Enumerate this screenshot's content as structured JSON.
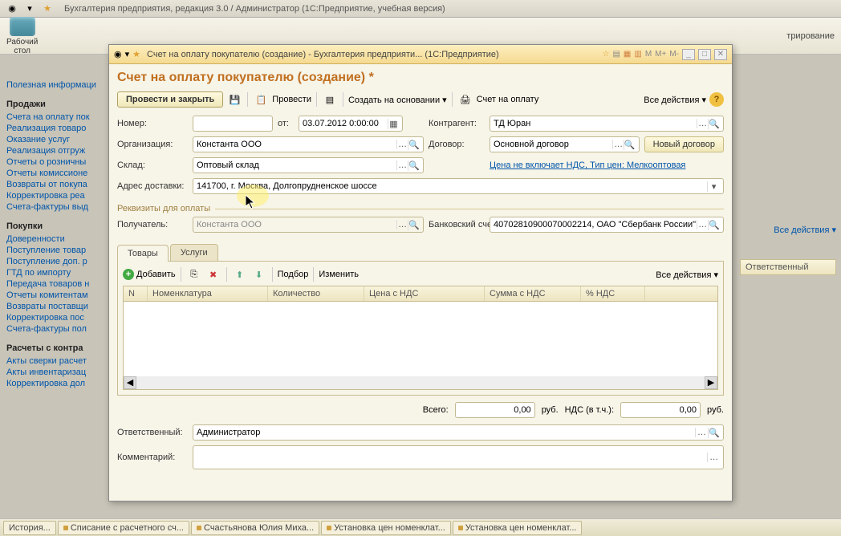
{
  "app_title": "Бухгалтерия предприятия, редакция 3.0 / Администратор    (1С:Предприятие, учебная версия)",
  "desktop": {
    "label": "Рабочий\nстол"
  },
  "admin_label": "трирование",
  "nav": {
    "info": "Полезная информаци",
    "sales": {
      "hdr": "Продажи",
      "items": [
        "Счета на оплату пок",
        "Реализация товаро",
        "Оказание услуг",
        "Реализация отгруж",
        "Отчеты о розничны",
        "Отчеты комиссионе",
        "Возвраты от покупа",
        "Корректировка реа",
        "Счета-фактуры выд"
      ]
    },
    "buy": {
      "hdr": "Покупки",
      "items": [
        "Доверенности",
        "Поступление товар",
        "Поступление доп. р",
        "ГТД по импорту",
        "Передача товаров н",
        "Отчеты комитентам",
        "Возвраты поставщи",
        "Корректировка пос",
        "Счета-фактуры пол"
      ]
    },
    "calc": {
      "hdr": "Расчеты с контра",
      "items": [
        "Акты сверки расчет",
        "Акты инвентаризац",
        "Корректировка дол"
      ]
    }
  },
  "modal": {
    "title": "Счет на оплату покупателю (создание) - Бухгалтерия предприяти...   (1С:Предприятие)",
    "doc_title": "Счет на оплату покупателю (создание) *",
    "cmd": {
      "main": "Провести и закрыть",
      "provesti": "Провести",
      "create_on": "Создать на основании",
      "invoice": "Счет на оплату",
      "all_actions": "Все действия"
    },
    "fields": {
      "number_lbl": "Номер:",
      "number_val": "",
      "ot_lbl": "от:",
      "date_val": "03.07.2012 0:00:00",
      "counterparty_lbl": "Контрагент:",
      "counterparty_val": "ТД Юран",
      "org_lbl": "Организация:",
      "org_val": "Константа ООО",
      "contract_lbl": "Договор:",
      "contract_val": "Основной договор",
      "new_contract": "Новый договор",
      "warehouse_lbl": "Склад:",
      "warehouse_val": "Оптовый склад",
      "price_link": "Цена не включает НДС, Тип цен: Мелкооптовая",
      "address_lbl": "Адрес доставки:",
      "address_val": "141700, г. Москва, Долгопрудненское шоссе",
      "requisites": "Реквизиты для оплаты",
      "recipient_lbl": "Получатель:",
      "recipient_val": "Константа ООО",
      "bank_lbl": "Банковский счет:",
      "bank_val": "40702810900070002214, ОАО \"Сбербанк России\"",
      "responsible_lbl": "Ответственный:",
      "responsible_val": "Администратор",
      "comment_lbl": "Комментарий:",
      "comment_val": ""
    },
    "tabs": {
      "goods": "Товары",
      "services": "Услуги"
    },
    "tbl_toolbar": {
      "add": "Добавить",
      "select": "Подбор",
      "edit": "Изменить",
      "all": "Все действия"
    },
    "grid_cols": [
      "N",
      "Номенклатура",
      "Количество",
      "Цена с НДС",
      "Сумма с НДС",
      "% НДС"
    ],
    "totals": {
      "total_lbl": "Всего:",
      "total_val": "0,00",
      "rub": "руб.",
      "nds_lbl": "НДС (в т.ч.):",
      "nds_val": "0,00"
    }
  },
  "right": {
    "all_actions": "Все действия",
    "col": "Ответственный"
  },
  "taskbar": {
    "history": "История...",
    "items": [
      "Списание с расчетного сч...",
      "Счастьянова Юлия Миха...",
      "Установка цен номенклат...",
      "Установка цен номенклат..."
    ]
  }
}
